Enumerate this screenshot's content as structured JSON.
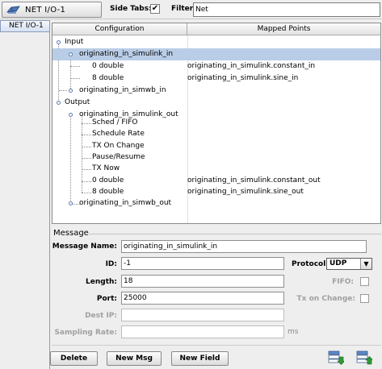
{
  "toolbar": {
    "title": "NET I/O-1",
    "side_tabs_label": "Side Tabs:",
    "side_tabs_checked": "✔",
    "filter_label": "Filter:",
    "filter_value": "Net"
  },
  "side_tabs": [
    {
      "label": "NET I/O-1"
    }
  ],
  "tree": {
    "columns": [
      "Configuration",
      "Mapped Points"
    ],
    "rows": [
      {
        "label": "Input",
        "mapped": ""
      },
      {
        "label": "originating_in_simulink_in",
        "mapped": ""
      },
      {
        "label": "0 double",
        "mapped": "originating_in_simulink.constant_in"
      },
      {
        "label": "8 double",
        "mapped": "originating_in_simulink.sine_in"
      },
      {
        "label": "originating_in_simwb_in",
        "mapped": ""
      },
      {
        "label": "Output",
        "mapped": ""
      },
      {
        "label": "originating_in_simulink_out",
        "mapped": ""
      },
      {
        "label": "Sched / FIFO",
        "mapped": ""
      },
      {
        "label": "Schedule Rate",
        "mapped": ""
      },
      {
        "label": "TX On Change",
        "mapped": ""
      },
      {
        "label": "Pause/Resume",
        "mapped": ""
      },
      {
        "label": "TX Now",
        "mapped": ""
      },
      {
        "label": "0 double",
        "mapped": "originating_in_simulink.constant_out"
      },
      {
        "label": "8 double",
        "mapped": "originating_in_simulink.sine_out"
      },
      {
        "label": "originating_in_simwb_out",
        "mapped": ""
      }
    ]
  },
  "message": {
    "section_title": "Message",
    "name_label": "Message Name:",
    "name_value": "originating_in_simulink_in",
    "id_label": "ID:",
    "id_value": "-1",
    "protocol_label": "Protocol:",
    "protocol_value": "UDP",
    "length_label": "Length:",
    "length_value": "18",
    "fifo_label": "FIFO:",
    "port_label": "Port:",
    "port_value": "25000",
    "tx_on_change_label": "Tx on Change:",
    "dest_ip_label": "Dest IP:",
    "dest_ip_value": "",
    "sampling_rate_label": "Sampling Rate:",
    "sampling_rate_value": "",
    "sampling_rate_unit": "ms"
  },
  "buttons": {
    "delete": "Delete",
    "new_msg": "New Msg",
    "new_field": "New Field"
  },
  "icons": {
    "title": "network-icon",
    "import": "import-down-icon",
    "export": "export-up-icon"
  },
  "colors": {
    "selection": "#b9cde6",
    "accent": "#3a6ea5",
    "tree_handle": "#5d7db0"
  }
}
